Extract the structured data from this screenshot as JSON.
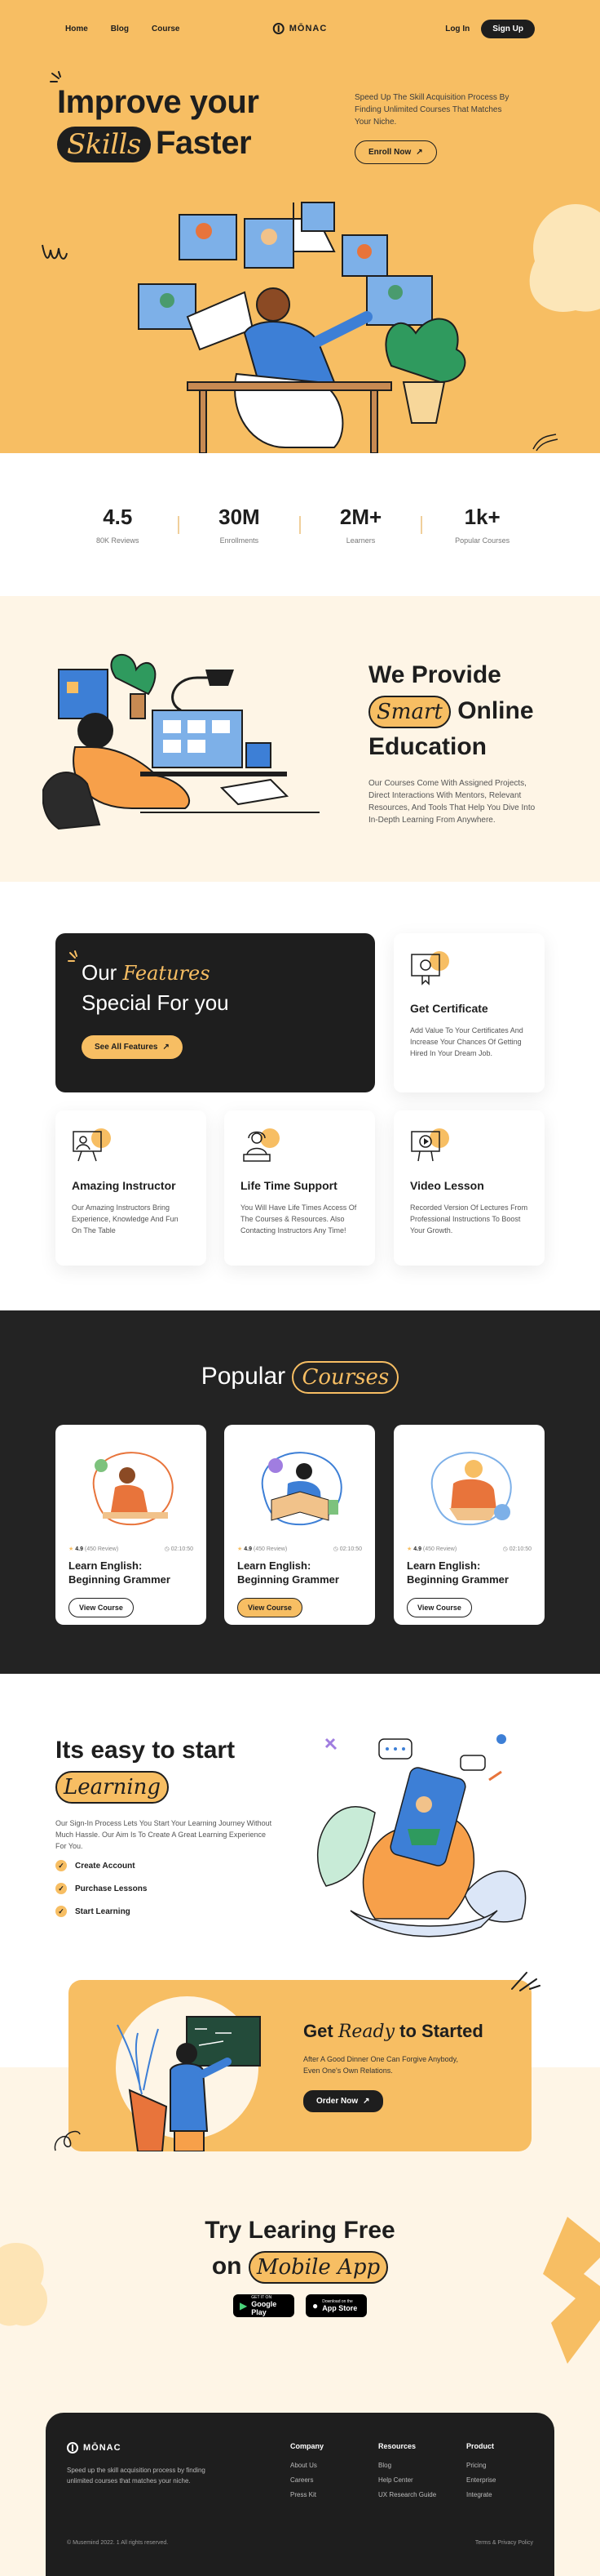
{
  "nav": {
    "links": [
      "Home",
      "Blog",
      "Course"
    ],
    "logo": "MŌNAC",
    "login": "Log In",
    "signup": "Sign Up"
  },
  "hero": {
    "title_line1": "Improve your",
    "title_pill": "Skills",
    "title_line2_rest": "Faster",
    "description": "Speed Up The Skill Acquisition Process By Finding Unlimited Courses That Matches Your Niche.",
    "cta": "Enroll Now"
  },
  "stats": [
    {
      "value": "4.5",
      "label": "80K Reviews"
    },
    {
      "value": "30M",
      "label": "Enrollments"
    },
    {
      "value": "2M+",
      "label": "Learners"
    },
    {
      "value": "1k+",
      "label": "Popular Courses"
    }
  ],
  "provide": {
    "line1": "We Provide",
    "pill": "Smart",
    "line2_rest": "Online",
    "line3": "Education",
    "description": "Our Courses Come With Assigned Projects, Direct Interactions With Mentors, Relevant Resources, And Tools That Help You Dive Into In-Depth Learning From Anywhere."
  },
  "features": {
    "title_our": "Our",
    "title_features": "Features",
    "title_line2": "Special For you",
    "cta": "See All Features",
    "cards": [
      {
        "title": "Get Certificate",
        "text": "Add Value To Your Certificates And Increase Your Chances Of Getting Hired In Your Dream Job."
      },
      {
        "title": "Amazing Instructor",
        "text": "Our Amazing Instructors Bring Experience, Knowledge And Fun On The Table"
      },
      {
        "title": "Life Time Support",
        "text": "You Will Have Life Times Access Of The Courses & Resources. Also Contacting Instructors Any Time!"
      },
      {
        "title": "Video Lesson",
        "text": "Recorded Version Of Lectures From Professional  Instructions To Boost Your Growth."
      }
    ]
  },
  "popular": {
    "title_word": "Popular",
    "title_pill": "Courses",
    "courses": [
      {
        "rating": "4.9",
        "reviews": "(450 Review)",
        "duration": "02:10:50",
        "title": "Learn English: Beginning Grammer",
        "cta": "View Course"
      },
      {
        "rating": "4.9",
        "reviews": "(450 Review)",
        "duration": "02:10:50",
        "title": "Learn English: Beginning Grammer",
        "cta": "View Course"
      },
      {
        "rating": "4.9",
        "reviews": "(450 Review)",
        "duration": "02:10:50",
        "title": "Learn English: Beginning Grammer",
        "cta": "View Course"
      }
    ]
  },
  "easy": {
    "line1": "Its easy to start",
    "pill": "Learning",
    "description": "Our Sign-In Process Lets You Start Your Learning Journey Without Much Hassle. Our Aim Is To Create A Great Learning Experience For You.",
    "checks": [
      "Create Account",
      "Purchase Lessons",
      "Start Learning"
    ]
  },
  "ready": {
    "title_get": "Get",
    "title_ready": "Ready",
    "title_rest": "to Started",
    "description": "After A Good Dinner One Can Forgive Anybody, Even One's Own Relations.",
    "cta": "Order Now"
  },
  "app": {
    "line1": "Try Learing Free",
    "line2_on": "on",
    "pill": "Mobile App",
    "google_small": "GET IT ON",
    "google_big": "Google Play",
    "apple_small": "Download on the",
    "apple_big": "App Store"
  },
  "footer": {
    "logo": "MŌNAC",
    "tagline": "Speed up the skill acquisition process by finding unlimited courses that matches your niche.",
    "columns": [
      {
        "title": "Company",
        "items": [
          "About Us",
          "Careers",
          "Press Kit"
        ]
      },
      {
        "title": "Resources",
        "items": [
          "Blog",
          "Help Center",
          "UX Research Guide"
        ]
      },
      {
        "title": "Product",
        "items": [
          "Pricing",
          "Enterprise",
          "Integrate"
        ]
      }
    ],
    "copyright": "© Musemind 2022.  1 All rights reserved.",
    "legal": "Terms & Privacy Policy"
  },
  "colors": {
    "accent": "#f7be63",
    "dark": "#1e1e1e",
    "cream": "#fef5e6"
  }
}
